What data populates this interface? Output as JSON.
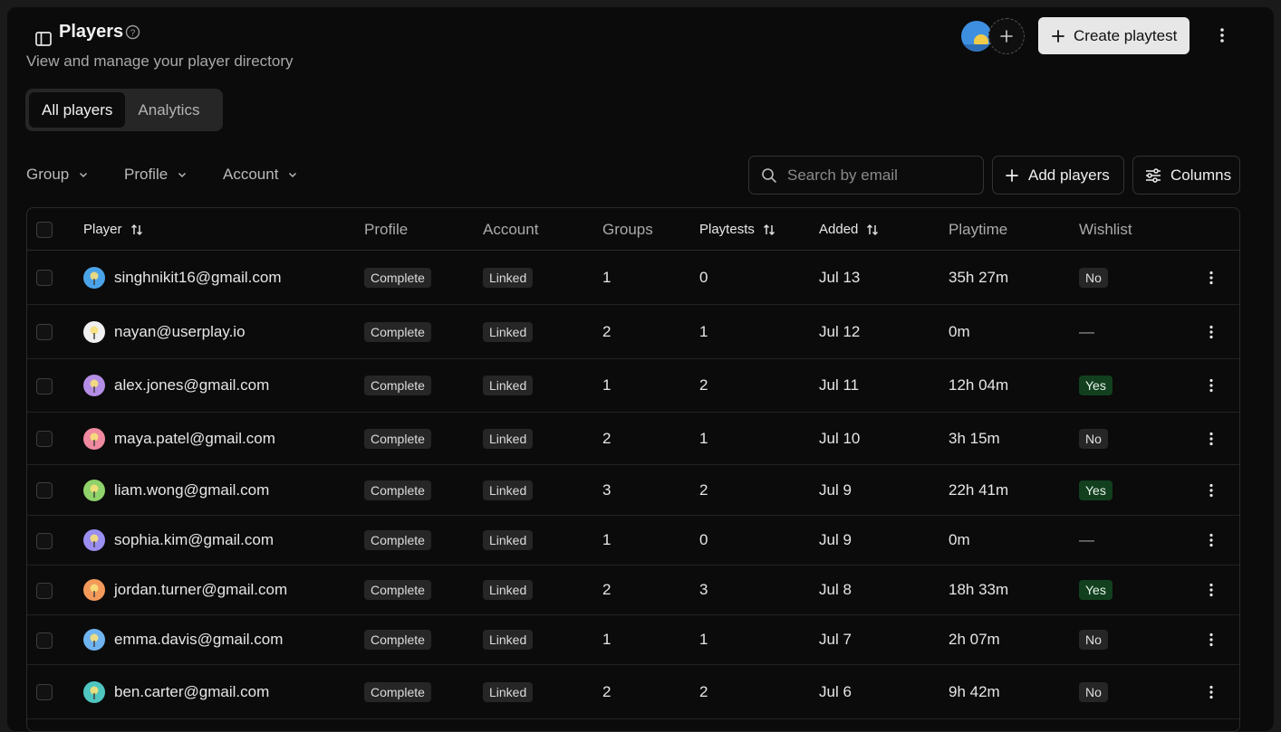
{
  "header": {
    "title": "Players",
    "subtitle": "View and manage your player directory",
    "create_label": "Create playtest"
  },
  "tabs": [
    {
      "label": "All players",
      "active": true
    },
    {
      "label": "Analytics",
      "active": false
    }
  ],
  "filters": [
    {
      "label": "Group"
    },
    {
      "label": "Profile"
    },
    {
      "label": "Account"
    }
  ],
  "search": {
    "placeholder": "Search by email",
    "value": ""
  },
  "toolbar": {
    "add_label": "Add players",
    "columns_label": "Columns"
  },
  "table": {
    "columns": [
      "Player",
      "Profile",
      "Account",
      "Groups",
      "Playtests",
      "Added",
      "Playtime",
      "Wishlist"
    ],
    "rows": [
      {
        "email": "singhnikit16@gmail.com",
        "profile": "Complete",
        "account": "Linked",
        "groups": "1",
        "playtests": "0",
        "added": "Jul 13",
        "playtime": "35h 27m",
        "wishlist": "No",
        "avatar": "#4aa3e8"
      },
      {
        "email": "nayan@userplay.io",
        "profile": "Complete",
        "account": "Linked",
        "groups": "2",
        "playtests": "1",
        "added": "Jul 12",
        "playtime": "0m",
        "wishlist": "—",
        "avatar": "#f0f0f0"
      },
      {
        "email": "alex.jones@gmail.com",
        "profile": "Complete",
        "account": "Linked",
        "groups": "1",
        "playtests": "2",
        "added": "Jul 11",
        "playtime": "12h 04m",
        "wishlist": "Yes",
        "avatar": "#b48de6"
      },
      {
        "email": "maya.patel@gmail.com",
        "profile": "Complete",
        "account": "Linked",
        "groups": "2",
        "playtests": "1",
        "added": "Jul 10",
        "playtime": "3h 15m",
        "wishlist": "No",
        "avatar": "#f08aa0"
      },
      {
        "email": "liam.wong@gmail.com",
        "profile": "Complete",
        "account": "Linked",
        "groups": "3",
        "playtests": "2",
        "added": "Jul 9",
        "playtime": "22h 41m",
        "wishlist": "Yes",
        "avatar": "#8fd36a"
      },
      {
        "email": "sophia.kim@gmail.com",
        "profile": "Complete",
        "account": "Linked",
        "groups": "1",
        "playtests": "0",
        "added": "Jul 9",
        "playtime": "0m",
        "wishlist": "—",
        "avatar": "#9a8ef0"
      },
      {
        "email": "jordan.turner@gmail.com",
        "profile": "Complete",
        "account": "Linked",
        "groups": "2",
        "playtests": "3",
        "added": "Jul 8",
        "playtime": "18h 33m",
        "wishlist": "Yes",
        "avatar": "#f39a5a"
      },
      {
        "email": "emma.davis@gmail.com",
        "profile": "Complete",
        "account": "Linked",
        "groups": "1",
        "playtests": "1",
        "added": "Jul 7",
        "playtime": "2h 07m",
        "wishlist": "No",
        "avatar": "#6fb3f0"
      },
      {
        "email": "ben.carter@gmail.com",
        "profile": "Complete",
        "account": "Linked",
        "groups": "2",
        "playtests": "2",
        "added": "Jul 6",
        "playtime": "9h 42m",
        "wishlist": "No",
        "avatar": "#4fc6c0"
      }
    ]
  },
  "colors": {
    "background": "#0b0b0b",
    "accent_yes": "#12401f",
    "primary_button": "#e7e7e7"
  }
}
